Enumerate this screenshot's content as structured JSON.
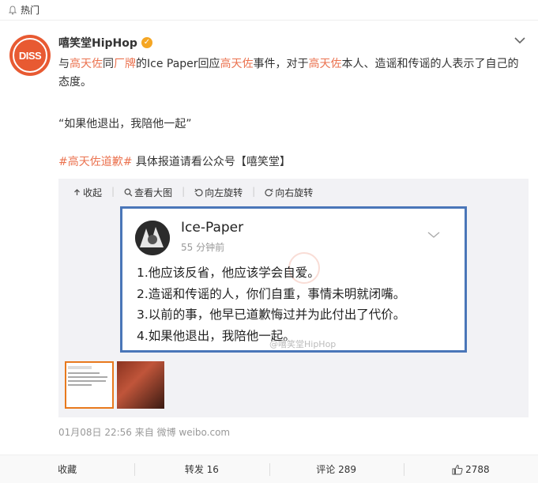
{
  "header": {
    "tab_label": "热门"
  },
  "post": {
    "username": "嘻笑堂HipHop",
    "avatar_text": "DISS",
    "text_parts": [
      "与",
      "高天佐",
      "同",
      "厂牌",
      "的Ice Paper回应",
      "高天佐",
      "事件，对于",
      "高天佐",
      "本人、造谣和传谣的人表示了自己的态度。"
    ],
    "quote": "“如果他退出，我陪他一起”",
    "hashtag": "#高天佐道歉#",
    "tag_suffix": " 具体报道请看公众号【嘻笑堂】",
    "timestamp": "01月08日 22:56 来自 微博 weibo.com"
  },
  "media": {
    "toolbar": {
      "collapse": "收起",
      "view_large": "查看大图",
      "rotate_left": "向左旋转",
      "rotate_right": "向右旋转"
    },
    "image": {
      "name": "Ice-Paper",
      "time": "55 分钟前",
      "lines": [
        "1.他应该反省，他应该学会自爱。",
        "2.造谣和传谣的人，你们自重，事情未明就闭嘴。",
        "3.以前的事，他早已道歉悔过并为此付出了代价。",
        "4.如果他退出，我陪他一起。"
      ],
      "watermark": "@嘻笑堂HipHop"
    }
  },
  "actions": {
    "collect": "收藏",
    "repost": "转发 16",
    "comment": "评论 289",
    "like": "2788"
  },
  "colors": {
    "accent": "#eb7350",
    "frame": "#4a76b8",
    "avatar": "#e85a32"
  }
}
